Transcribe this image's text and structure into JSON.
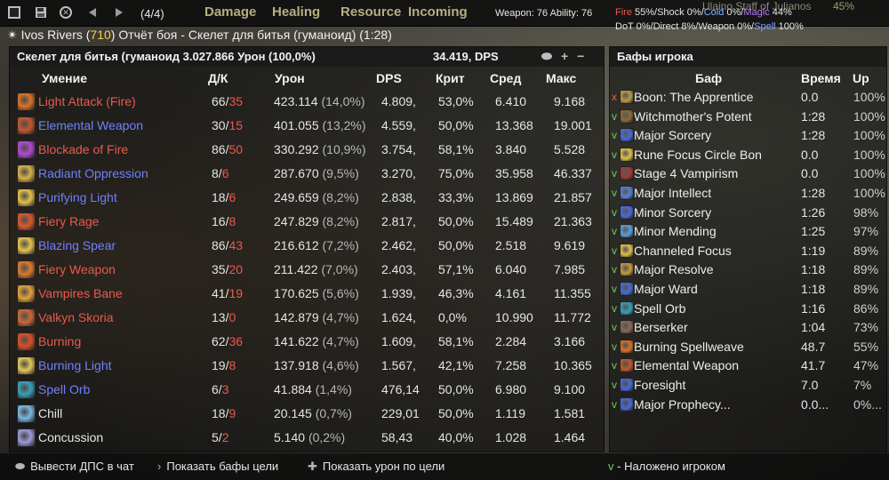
{
  "toolbar": {
    "fight_counter": "(4/4)",
    "tabs": [
      "Damage",
      "Healing",
      "Resource",
      "Incoming"
    ],
    "weapon_ability": "Weapon: 76 Ability: 76",
    "stats_line1": {
      "fire_label": "Fire",
      "fire_val": " 55%/",
      "shock": "Shock 0%/",
      "cold_label": "Cold",
      "cold_val": " 0%/",
      "magic_label": "Magic",
      "magic_val": " 44%"
    },
    "stats_line2": {
      "prefix": "DoT 0%/Direct 8%/Weapon 0%/",
      "spell_label": "Spell",
      "spell_val": " 100%"
    },
    "background_text": "Ulaino Staff of Julianos",
    "background_pct": "45%"
  },
  "title": {
    "prefix": "✴ Ivos Rivers (",
    "level": "710",
    "suffix": ") Отчёт боя - Скелет для битья (гуманоид) (1:28)"
  },
  "left_panel": {
    "target_line": "Скелет для битья (гуманоид 3.027.866 Урон (100,0%)",
    "dps_line": "34.419, DPS",
    "columns": {
      "name": "Умение",
      "hits_crits": "Д/К",
      "damage": "Урон",
      "dps": "DPS",
      "crit": "Крит",
      "avg": "Сред",
      "max": "Макс"
    },
    "abilities": [
      {
        "name": "Light Attack (Fire)",
        "type": "fire",
        "hits": "66",
        "crits": "35",
        "damage": "423.114",
        "pct": "(14,0%)",
        "dps": "4.809,",
        "crit": "53,0%",
        "avg": "6.410",
        "max": "9.168",
        "icon_color": "#d8742a"
      },
      {
        "name": "Elemental Weapon",
        "type": "magic",
        "hits": "30",
        "crits": "15",
        "damage": "401.055",
        "pct": "(13,2%)",
        "dps": "4.559,",
        "crit": "50,0%",
        "avg": "13.368",
        "max": "19.001",
        "icon_color": "#c25a30"
      },
      {
        "name": "Blockade of Fire",
        "type": "fire",
        "hits": "86",
        "crits": "50",
        "damage": "330.292",
        "pct": "(10,9%)",
        "dps": "3.754,",
        "crit": "58,1%",
        "avg": "3.840",
        "max": "5.528",
        "icon_color": "#b04bd1"
      },
      {
        "name": "Radiant Oppression",
        "type": "magic",
        "hits": "8",
        "crits": "6",
        "damage": "287.670",
        "pct": "(9,5%)",
        "dps": "3.270,",
        "crit": "75,0%",
        "avg": "35.958",
        "max": "46.337",
        "icon_color": "#d7b04a"
      },
      {
        "name": "Purifying Light",
        "type": "magic",
        "hits": "18",
        "crits": "6",
        "damage": "249.659",
        "pct": "(8,2%)",
        "dps": "2.838,",
        "crit": "33,3%",
        "avg": "13.869",
        "max": "21.857",
        "icon_color": "#e0c04a"
      },
      {
        "name": "Fiery Rage",
        "type": "fire",
        "hits": "16",
        "crits": "8",
        "damage": "247.829",
        "pct": "(8,2%)",
        "dps": "2.817,",
        "crit": "50,0%",
        "avg": "15.489",
        "max": "21.363",
        "icon_color": "#d85a30"
      },
      {
        "name": "Blazing Spear",
        "type": "magic",
        "hits": "86",
        "crits": "43",
        "damage": "216.612",
        "pct": "(7,2%)",
        "dps": "2.462,",
        "crit": "50,0%",
        "avg": "2.518",
        "max": "9.619",
        "icon_color": "#e3c24f"
      },
      {
        "name": "Fiery Weapon",
        "type": "fire",
        "hits": "35",
        "crits": "20",
        "damage": "211.422",
        "pct": "(7,0%)",
        "dps": "2.403,",
        "crit": "57,1%",
        "avg": "6.040",
        "max": "7.985",
        "icon_color": "#d87a32"
      },
      {
        "name": "Vampires Bane",
        "type": "fire",
        "hits": "41",
        "crits": "19",
        "damage": "170.625",
        "pct": "(5,6%)",
        "dps": "1.939,",
        "crit": "46,3%",
        "avg": "4.161",
        "max": "11.355",
        "icon_color": "#e0a23c"
      },
      {
        "name": "Valkyn Skoria",
        "type": "fire",
        "hits": "13",
        "crits": "0",
        "damage": "142.879",
        "pct": "(4,7%)",
        "dps": "1.624,",
        "crit": "0,0%",
        "avg": "10.990",
        "max": "11.772",
        "icon_color": "#c86a3a"
      },
      {
        "name": "Burning",
        "type": "fire",
        "hits": "62",
        "crits": "36",
        "damage": "141.622",
        "pct": "(4,7%)",
        "dps": "1.609,",
        "crit": "58,1%",
        "avg": "2.284",
        "max": "3.166",
        "icon_color": "#d8502a"
      },
      {
        "name": "Burning Light",
        "type": "magic",
        "hits": "19",
        "crits": "8",
        "damage": "137.918",
        "pct": "(4,6%)",
        "dps": "1.567,",
        "crit": "42,1%",
        "avg": "7.258",
        "max": "10.365",
        "icon_color": "#e0c85a"
      },
      {
        "name": "Spell Orb",
        "type": "magic",
        "hits": "6",
        "crits": "3",
        "damage": "41.884",
        "pct": "(1,4%)",
        "dps": "476,14",
        "crit": "50,0%",
        "avg": "6.980",
        "max": "9.100",
        "icon_color": "#3aa0b8"
      },
      {
        "name": "Chill",
        "type": "phys",
        "hits": "18",
        "crits": "9",
        "damage": "20.145",
        "pct": "(0,7%)",
        "dps": "229,01",
        "crit": "50,0%",
        "avg": "1.119",
        "max": "1.581",
        "icon_color": "#7ab8e0"
      },
      {
        "name": "Concussion",
        "type": "phys",
        "hits": "5",
        "crits": "2",
        "damage": "5.140",
        "pct": "(0,2%)",
        "dps": "58,43",
        "crit": "40,0%",
        "avg": "1.028",
        "max": "1.464",
        "icon_color": "#9a9ad8"
      }
    ]
  },
  "right_panel": {
    "title": "Бафы игрока",
    "columns": {
      "buff": "Баф",
      "time": "Время",
      "up": "Up"
    },
    "buffs": [
      {
        "mark": "x",
        "name": "Boon: The Apprentice",
        "time": "0.0",
        "up": "100%",
        "icon_color": "#b89a4a"
      },
      {
        "mark": "v",
        "name": "Witchmother's Potent",
        "time": "1:28",
        "up": "100%",
        "icon_color": "#8a6a3a"
      },
      {
        "mark": "v",
        "name": "Major Sorcery",
        "time": "1:28",
        "up": "100%",
        "icon_color": "#4a6ad8"
      },
      {
        "mark": "v",
        "name": "Rune Focus Circle Bon",
        "time": "0.0",
        "up": "100%",
        "icon_color": "#e0c04a"
      },
      {
        "mark": "v",
        "name": "Stage 4 Vampirism",
        "time": "0.0",
        "up": "100%",
        "icon_color": "#a03a3a"
      },
      {
        "mark": "v",
        "name": "Major Intellect",
        "time": "1:28",
        "up": "100%",
        "icon_color": "#5a80d0"
      },
      {
        "mark": "v",
        "name": "Minor Sorcery",
        "time": "1:26",
        "up": "98%",
        "icon_color": "#4a6ad8"
      },
      {
        "mark": "v",
        "name": "Minor Mending",
        "time": "1:25",
        "up": "97%",
        "icon_color": "#5aa0d8"
      },
      {
        "mark": "v",
        "name": "Channeled Focus",
        "time": "1:19",
        "up": "89%",
        "icon_color": "#e0c04a"
      },
      {
        "mark": "v",
        "name": "Major Resolve",
        "time": "1:18",
        "up": "89%",
        "icon_color": "#c89a3a"
      },
      {
        "mark": "v",
        "name": "Major Ward",
        "time": "1:18",
        "up": "89%",
        "icon_color": "#4a6ad8"
      },
      {
        "mark": "v",
        "name": "Spell Orb",
        "time": "1:16",
        "up": "86%",
        "icon_color": "#3aa0b8"
      },
      {
        "mark": "v",
        "name": "Berserker",
        "time": "1:04",
        "up": "73%",
        "icon_color": "#8a6a5a"
      },
      {
        "mark": "v",
        "name": "Burning Spellweave",
        "time": "48.7",
        "up": "55%",
        "icon_color": "#d8742a"
      },
      {
        "mark": "v",
        "name": "Elemental Weapon",
        "time": "41.7",
        "up": "47%",
        "icon_color": "#c25a30"
      },
      {
        "mark": "v",
        "name": "Foresight",
        "time": "7.0",
        "up": "7%",
        "icon_color": "#4a6ad8"
      },
      {
        "mark": "v",
        "name": "Major Prophecy...",
        "time": "0.0...",
        "up": "0%...",
        "icon_color": "#4a6ad8"
      }
    ]
  },
  "bottom_bar": {
    "post_dps": "Вывести ДПС в чат",
    "show_target_buffs": "Показать бафы цели",
    "show_target_damage": "Показать урон по цели",
    "legend": "- Наложено игроком",
    "legend_mark": "v"
  },
  "icons": {
    "window-square": "square",
    "save": "disk",
    "close": "x-circle",
    "prev": "triangle-left",
    "next": "triangle-right",
    "bullet": "ellipse",
    "arrow": "chevron-right",
    "plus": "plus"
  }
}
